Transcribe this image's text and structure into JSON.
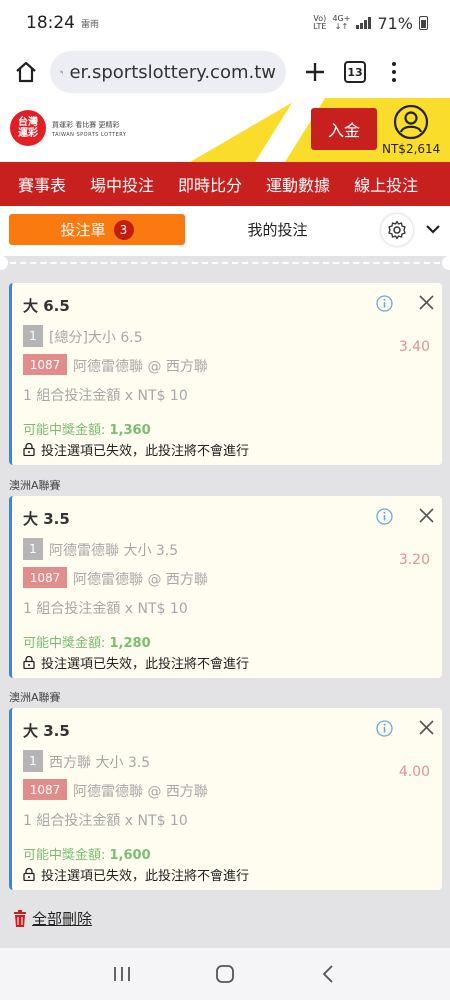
{
  "status": {
    "time": "18:24",
    "note": "雷雨",
    "signal_small_top": "Vo)",
    "signal_small_bottom": "LTE",
    "net_top": "4G+",
    "net_bottom": "↓↑",
    "battery": "71%"
  },
  "browser": {
    "url": "er.sportslottery.com.tw",
    "tab_count": "13"
  },
  "site": {
    "logo_top": "台灣",
    "logo_bottom": "運彩",
    "slogan": "買運彩  看比賽  更精彩",
    "slogan_en": "TAIWAN SPORTS LOTTERY",
    "deposit": "入金",
    "balance": "NT$2,614"
  },
  "nav": [
    "賽事表",
    "場中投注",
    "即時比分",
    "運動數據",
    "線上投注"
  ],
  "slip": {
    "tab_label": "投注單",
    "count": "3",
    "my_bets": "我的投注"
  },
  "bets": [
    {
      "league": "",
      "title": "大 6.5",
      "num": "1",
      "market": "[總分]大小 6.5",
      "code": "1087",
      "teams": "阿德雷德聯 @ 西方聯",
      "odds": "3.40",
      "stake": "1 組合投注金額 x NT$ 10",
      "prize_label": "可能中獎金額: ",
      "prize": "1,360",
      "warning": "投注選項已失效，此投注將不會進行"
    },
    {
      "league": "澳洲A聯賽",
      "title": "大 3.5",
      "num": "1",
      "market": "阿德雷德聯 大小 3.5",
      "code": "1087",
      "teams": "阿德雷德聯 @ 西方聯",
      "odds": "3.20",
      "stake": "1 組合投注金額 x NT$ 10",
      "prize_label": "可能中獎金額: ",
      "prize": "1,280",
      "warning": "投注選項已失效，此投注將不會進行"
    },
    {
      "league": "澳洲A聯賽",
      "title": "大 3.5",
      "num": "1",
      "market": "西方聯 大小 3.5",
      "code": "1087",
      "teams": "阿德雷德聯 @ 西方聯",
      "odds": "4.00",
      "stake": "1 組合投注金額 x NT$ 10",
      "prize_label": "可能中獎金額: ",
      "prize": "1,600",
      "warning": "投注選項已失效，此投注將不會進行"
    }
  ],
  "delete_all": "全部刪除",
  "colors": {
    "brand_red": "#c8201e",
    "accent_orange": "#fb7a0f",
    "card_border": "#3f88cc",
    "prize_green": "#7bbe72"
  }
}
